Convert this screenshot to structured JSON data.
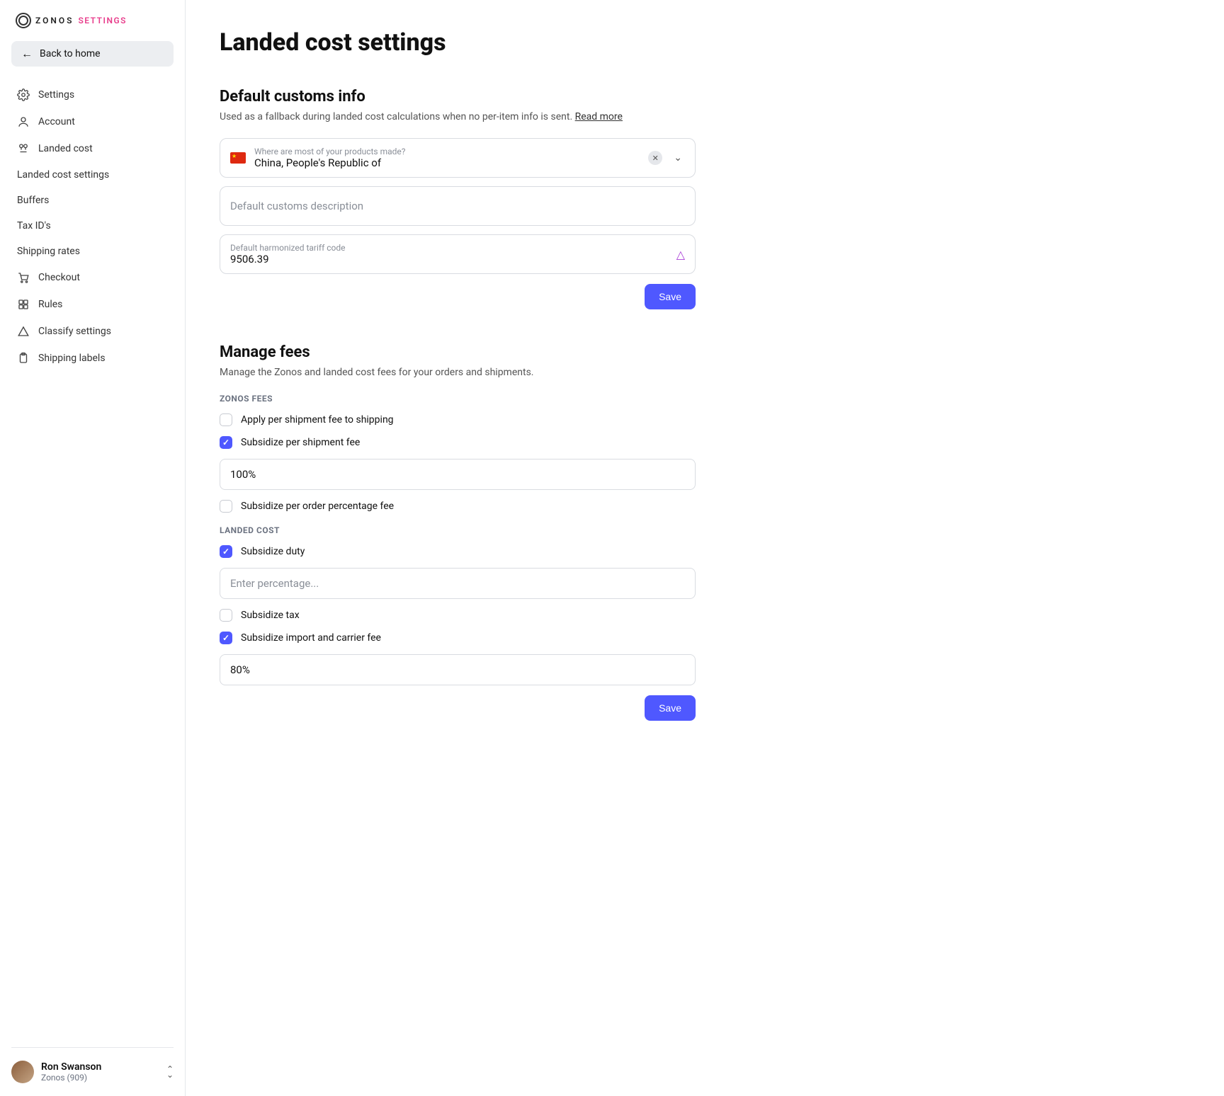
{
  "brand": {
    "name": "ZONOS",
    "section": "SETTINGS"
  },
  "sidebar": {
    "back_label": "Back to home",
    "items": [
      {
        "label": "Settings"
      },
      {
        "label": "Account"
      },
      {
        "label": "Landed cost"
      },
      {
        "label": "Checkout"
      },
      {
        "label": "Rules"
      },
      {
        "label": "Classify settings"
      },
      {
        "label": "Shipping labels"
      }
    ],
    "landed_cost_sub": [
      {
        "label": "Landed cost settings",
        "active": true
      },
      {
        "label": "Buffers"
      },
      {
        "label": "Tax ID's"
      },
      {
        "label": "Shipping rates"
      }
    ],
    "user": {
      "name": "Ron Swanson",
      "org": "Zonos (909)"
    }
  },
  "page": {
    "title": "Landed cost settings",
    "section1": {
      "title": "Default customs info",
      "desc": "Used as a fallback during landed cost calculations when no per-item info is sent. ",
      "read_more": "Read more",
      "country_label": "Where are most of your products made?",
      "country_value": "China, People's Republic of",
      "customs_desc_placeholder": "Default customs description",
      "hs_label": "Default harmonized tariff code",
      "hs_value": "9506.39",
      "save": "Save"
    },
    "section2": {
      "title": "Manage fees",
      "desc": "Manage the Zonos and landed cost fees for your orders and shipments.",
      "zonos_fees_header": "ZONOS FEES",
      "apply_per_shipment": "Apply per shipment fee to shipping",
      "subsidize_per_shipment": "Subsidize per shipment fee",
      "subsidize_per_shipment_value": "100%",
      "subsidize_per_order": "Subsidize per order percentage fee",
      "landed_cost_header": "LANDED COST",
      "subsidize_duty": "Subsidize duty",
      "duty_placeholder": "Enter percentage...",
      "subsidize_tax": "Subsidize tax",
      "subsidize_import": "Subsidize import and carrier fee",
      "subsidize_import_value": "80%",
      "save": "Save"
    }
  }
}
